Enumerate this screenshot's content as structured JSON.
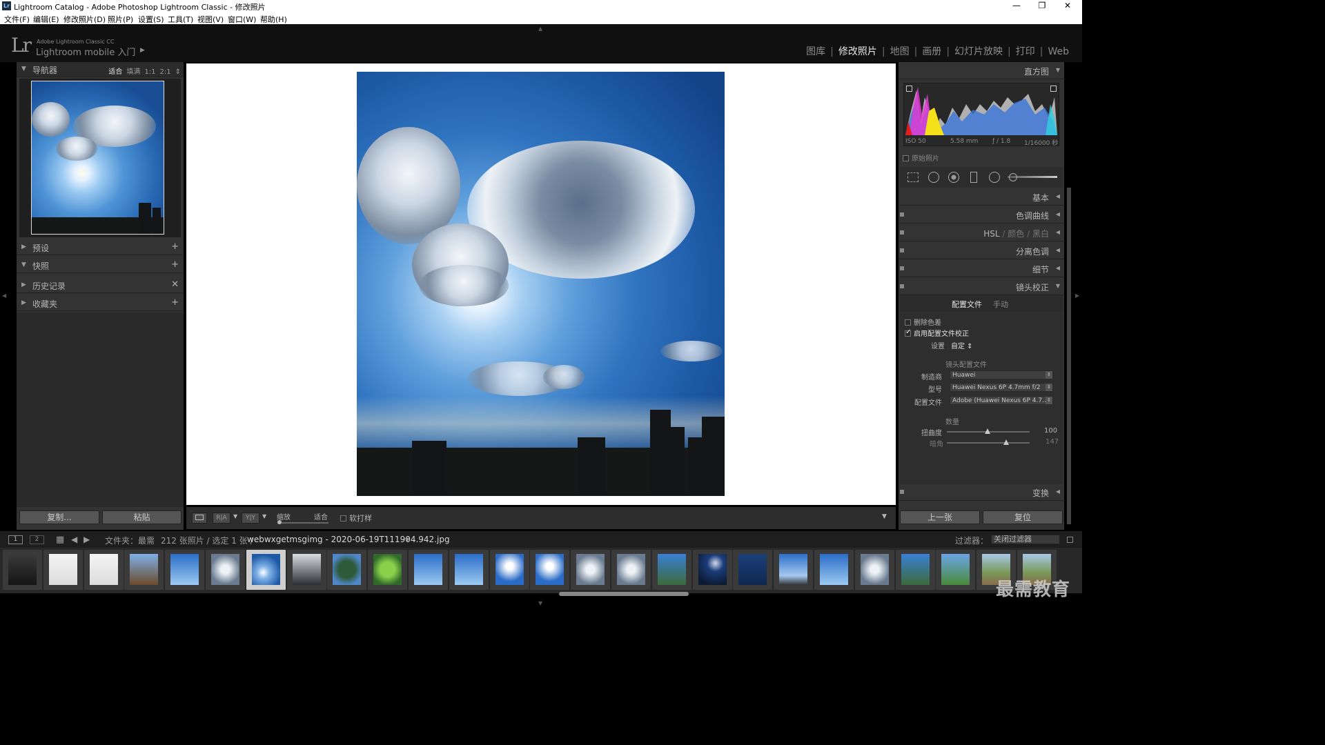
{
  "window": {
    "title": "Lightroom Catalog - Adobe Photoshop Lightroom Classic - 修改照片",
    "app_icon_text": "Lr",
    "controls": {
      "minimize": "—",
      "maximize": "❐",
      "close": "✕"
    }
  },
  "menu": [
    "文件(F)",
    "编辑(E)",
    "修改照片(D)",
    "照片(P)",
    "设置(S)",
    "工具(T)",
    "视图(V)",
    "窗口(W)",
    "帮助(H)"
  ],
  "header": {
    "logo": "Lr",
    "product": "Adobe Lightroom Classic CC",
    "mobile_prompt": "Lightroom mobile 入门",
    "mobile_arrow": "▶",
    "modules": [
      {
        "label": "图库",
        "active": false
      },
      {
        "label": "修改照片",
        "active": true
      },
      {
        "label": "地图",
        "active": false
      },
      {
        "label": "画册",
        "active": false
      },
      {
        "label": "幻灯片放映",
        "active": false
      },
      {
        "label": "打印",
        "active": false
      },
      {
        "label": "Web",
        "active": false
      }
    ]
  },
  "left_panel": {
    "navigator": {
      "title": "导航器",
      "options": [
        "适合",
        "填满",
        "1:1",
        "2:1"
      ],
      "active_option": "适合",
      "dropdown": "⇕"
    },
    "sections": [
      {
        "title": "预设",
        "action": "+",
        "expanded": false
      },
      {
        "title": "快照",
        "action": "+",
        "expanded": true
      },
      {
        "title": "历史记录",
        "action": "✕",
        "expanded": false
      },
      {
        "title": "收藏夹",
        "action": "+",
        "expanded": false
      }
    ],
    "copy_button": "复制...",
    "paste_button": "粘贴"
  },
  "toolbar": {
    "view_mode_icon": "loupe-view-icon",
    "before_after_label": "R|A",
    "yy_label": "Y|Y",
    "zoom_label": "缩放",
    "zoom_value": "适合",
    "softproof_label": "软打样",
    "menu_arrow": "▼"
  },
  "right_panel": {
    "histogram": {
      "title": "直方图",
      "iso": "ISO 50",
      "focal": "5.58 mm",
      "aperture": "ƒ / 1.8",
      "shutter": "1/16000 秒",
      "original_photo": "原始照片"
    },
    "sections": [
      {
        "label": "基本",
        "arrow": "◀"
      },
      {
        "label": "色调曲线",
        "arrow": "◀"
      },
      {
        "label_parts": [
          "HSL",
          "颜色",
          "黑白"
        ],
        "arrow": "◀"
      },
      {
        "label": "分离色调",
        "arrow": "◀"
      },
      {
        "label": "细节",
        "arrow": "◀"
      },
      {
        "label": "镜头校正",
        "arrow": "▼"
      }
    ],
    "lens": {
      "tab_profile": "配置文件",
      "tab_manual": "手动",
      "remove_ca": "删除色差",
      "remove_ca_checked": false,
      "enable_profile": "启用配置文件校正",
      "enable_profile_checked": true,
      "setup_label": "设置",
      "setup_value": "自定 ⇕",
      "profile_section": "镜头配置文件",
      "make_label": "制造商",
      "make_value": "Huawei",
      "model_label": "型号",
      "model_value": "Huawei Nexus 6P 4.7mm f/2",
      "profile_label": "配置文件",
      "profile_value": "Adobe (Huawei Nexus 6P 4.7...",
      "amount_section": "数量",
      "distortion_label": "扭曲度",
      "distortion_value": "100",
      "vignette_label": "暗角",
      "vignette_value": "147"
    },
    "transform": {
      "label": "变换",
      "arrow": "◀"
    },
    "prev_button": "上一张",
    "reset_button": "复位"
  },
  "filmstrip_bar": {
    "page1": "1",
    "page2": "2",
    "folder_label": "文件夹：最需",
    "count": "212 张照片 / 选定 1 张 /",
    "filename": "webwxgetmsgimg - 2020-06-19T111904.942.jpg",
    "filter_label": "过滤器：",
    "filter_value": "关闭过滤器"
  },
  "filmstrip": {
    "selected_index": 6,
    "thumbs": [
      "dark",
      "tree-white",
      "tree-white",
      "building",
      "sky",
      "cloud-gray",
      "sky-selected",
      "tree-dark",
      "tree-green",
      "leaf-green",
      "sky",
      "sky",
      "sky-cloud",
      "sky-cloud",
      "cloud-gray",
      "cloud-gray",
      "sky-tree",
      "night",
      "dark-blue",
      "sky-city",
      "sky",
      "cloud-gray",
      "sky-tree",
      "sky-green",
      "road",
      "road",
      "sky"
    ]
  },
  "watermark": "最需教育",
  "colors": {
    "accent_active": "#e6e6e6",
    "panel_bg": "#333333",
    "chrome_bg": "#101010"
  }
}
